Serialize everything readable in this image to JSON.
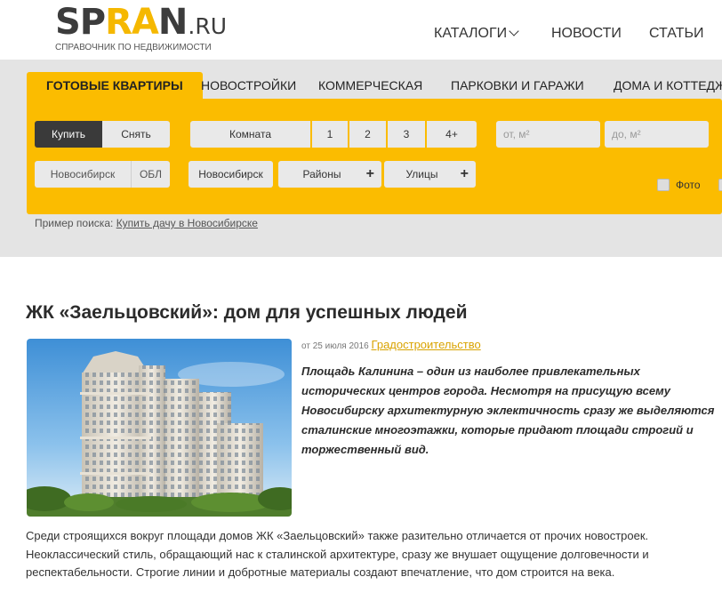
{
  "logo": {
    "main_a": "SP",
    "main_b": "RA",
    "main_c": "N",
    "tld": ".RU",
    "tagline": "СПРАВОЧНИК ПО НЕДВИЖИМОСТИ"
  },
  "topnav": {
    "catalogs": "КАТАЛОГИ",
    "news": "НОВОСТИ",
    "articles": "СТАТЬИ"
  },
  "tabs": [
    "ГОТОВЫЕ КВАРТИРЫ",
    "НОВОСТРОЙКИ",
    "КОММЕРЧЕСКАЯ",
    "ПАРКОВКИ И ГАРАЖИ",
    "ДОМА И КОТТЕДЖИ"
  ],
  "filters": {
    "buy": "Купить",
    "rent": "Снять",
    "room": "Комната",
    "r1": "1",
    "r2": "2",
    "r3": "3",
    "r4": "4+",
    "area_from": "от, м²",
    "area_to": "до, м²",
    "city": "Новосибирск",
    "region": "ОБЛ",
    "city2": "Новосибирск",
    "districts": "Районы",
    "streets": "Улицы",
    "photo": "Фото"
  },
  "example": {
    "prefix": "Пример поиска:",
    "link": "Купить дачу в Новосибирске"
  },
  "article": {
    "title": "ЖК «Заельцовский»: дом для успешных людей",
    "date": "от 25 июля 2016",
    "category": "Градостроительство",
    "lead": "Площадь Калинина – один из наиболее привлекательных исторических центров города. Несмотря на присущую всему Новосибирску архитектурную эклектичность сразу же выделяются сталинские многоэтажки, которые придают площади строгий и торжественный вид.",
    "body": "Среди строящихся вокруг площади домов ЖК «Заельцовский» также разительно отличается от прочих новостроек. Неоклассический стиль, обращающий нас к сталинской архитектуре, сразу же внушает ощущение долговечности и респектабельности. Строгие линии и добротные материалы создают впечатление, что дом строится на века."
  },
  "colors": {
    "accent": "#fbbc00",
    "panel_bg": "#e4e4e4",
    "dark_button": "#3a3a3a",
    "link": "#d9a300"
  }
}
